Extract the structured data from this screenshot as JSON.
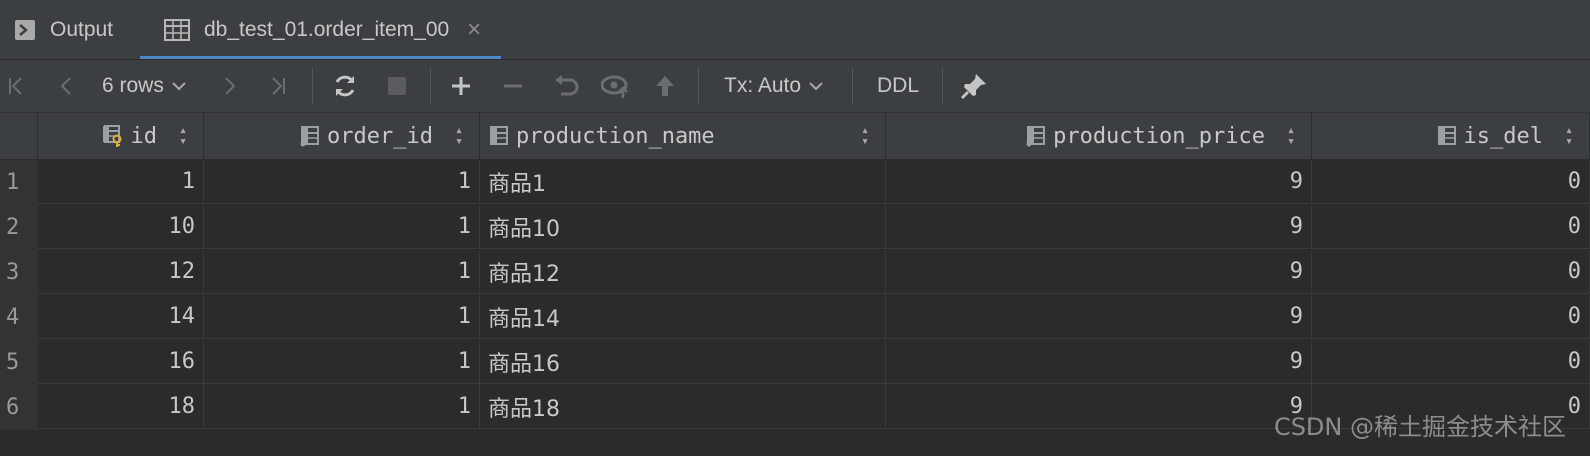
{
  "tabs": {
    "output_label": "Output",
    "active_label": "db_test_01.order_item_00",
    "close_glyph": "×"
  },
  "toolbar": {
    "rows_label": "6 rows",
    "tx_label": "Tx: Auto",
    "ddl_label": "DDL"
  },
  "columns": [
    {
      "name": "id"
    },
    {
      "name": "order_id"
    },
    {
      "name": "production_name"
    },
    {
      "name": "production_price"
    },
    {
      "name": "is_del"
    }
  ],
  "rows": [
    {
      "n": "1",
      "id": "1",
      "order_id": "1",
      "name": "商品1",
      "price": "9",
      "is_del": "0"
    },
    {
      "n": "2",
      "id": "10",
      "order_id": "1",
      "name": "商品10",
      "price": "9",
      "is_del": "0"
    },
    {
      "n": "3",
      "id": "12",
      "order_id": "1",
      "name": "商品12",
      "price": "9",
      "is_del": "0"
    },
    {
      "n": "4",
      "id": "14",
      "order_id": "1",
      "name": "商品14",
      "price": "9",
      "is_del": "0"
    },
    {
      "n": "5",
      "id": "16",
      "order_id": "1",
      "name": "商品16",
      "price": "9",
      "is_del": "0"
    },
    {
      "n": "6",
      "id": "18",
      "order_id": "1",
      "name": "商品18",
      "price": "9",
      "is_del": "0"
    }
  ],
  "watermark": "CSDN @稀土掘金技术社区"
}
